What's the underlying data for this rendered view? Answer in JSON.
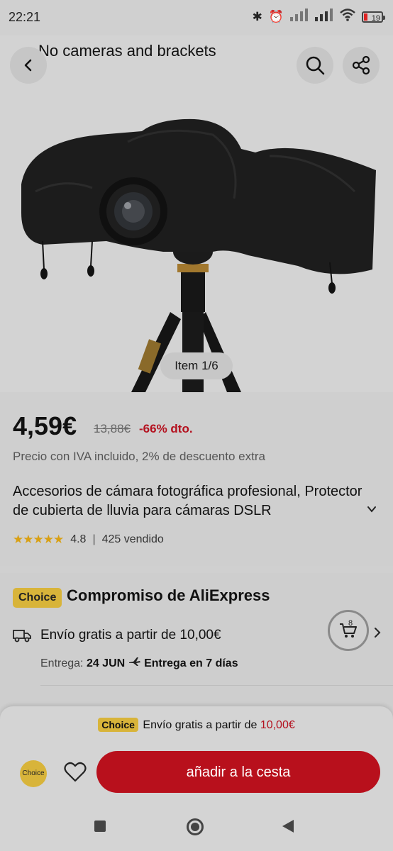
{
  "status_bar": {
    "time": "22:21",
    "battery": "19"
  },
  "header": {
    "search_text": "No cameras and brackets"
  },
  "gallery": {
    "counter": "Item 1/6"
  },
  "product": {
    "price": "4,59€",
    "original_price": "13,88€",
    "discount": "-66% dto.",
    "tax_note": "Precio con IVA incluido, 2% de descuento extra",
    "title": "Accesorios de cámara fotográfica profesional, Protector de cubierta de lluvia para cámaras DSLR",
    "rating": "4.8",
    "sold": "425 vendido",
    "stars": "★★★★★"
  },
  "choice": {
    "badge": "Choice",
    "title": "Compromiso de AliExpress",
    "shipping": "Envío gratis a partir de 10,00€",
    "delivery_label": "Entrega:",
    "delivery_date": "24 JUN",
    "delivery_days": "Entrega en 7 días",
    "cart_count": "8"
  },
  "bottom_bar": {
    "promo_badge": "Choice",
    "promo_text": "Envío gratis a partir de",
    "promo_amount": "10,00€",
    "choice_circle": "Choice",
    "add_to_cart": "añadir a la cesta"
  },
  "colors": {
    "accent_red": "#b8101c",
    "choice_gold": "#d8b43a",
    "star_gold": "#d8a014"
  }
}
